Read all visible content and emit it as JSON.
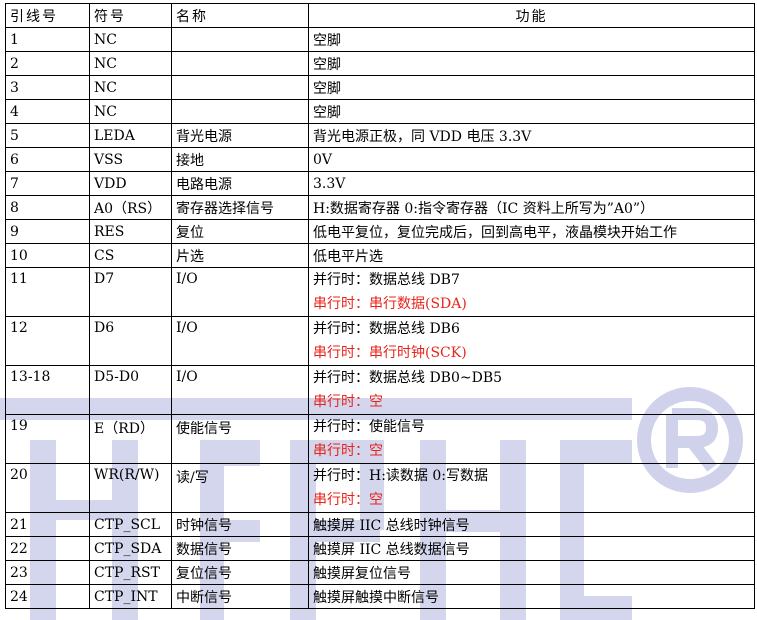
{
  "headers": [
    "引线号",
    "符号",
    "名称",
    "功能"
  ],
  "colors": {
    "border": "#000000",
    "red_text": "#e8241b",
    "watermark": "#cfd2ea"
  },
  "watermark": {
    "icon": "registered-trademark-icon"
  },
  "rows": [
    {
      "pin": "1",
      "symbol": "NC",
      "name": "",
      "func": [
        "空脚"
      ]
    },
    {
      "pin": "2",
      "symbol": "NC",
      "name": "",
      "func": [
        "空脚"
      ]
    },
    {
      "pin": "3",
      "symbol": "NC",
      "name": "",
      "func": [
        "空脚"
      ]
    },
    {
      "pin": "4",
      "symbol": "NC",
      "name": "",
      "func": [
        "空脚"
      ]
    },
    {
      "pin": "5",
      "symbol": "LEDA",
      "name": "背光电源",
      "func": [
        "背光电源正极，同 VDD 电压 3.3V"
      ]
    },
    {
      "pin": "6",
      "symbol": "VSS",
      "name": "接地",
      "func": [
        "0V"
      ]
    },
    {
      "pin": "7",
      "symbol": "VDD",
      "name": "电路电源",
      "func": [
        "3.3V"
      ]
    },
    {
      "pin": "8",
      "symbol": "A0（RS）",
      "name": "寄存器选择信号",
      "func": [
        "H:数据寄存器 0:指令寄存器（IC 资料上所写为”A0”）"
      ]
    },
    {
      "pin": "9",
      "symbol": "RES",
      "name": "复位",
      "func": [
        "低电平复位，复位完成后，回到高电平，液晶模块开始工作"
      ]
    },
    {
      "pin": "10",
      "symbol": "CS",
      "name": "片选",
      "func": [
        "低电平片选"
      ]
    },
    {
      "pin": "11",
      "symbol": "D7",
      "name": "I/O",
      "func": [
        "并行时：数据总线 DB7",
        "串行时：串行数据(SDA)"
      ]
    },
    {
      "pin": "12",
      "symbol": "D6",
      "name": "I/O",
      "func": [
        "并行时：数据总线 DB6",
        "串行时：串行时钟(SCK)"
      ]
    },
    {
      "pin": "13-18",
      "symbol": "D5-D0",
      "name": "I/O",
      "func": [
        "并行时：数据总线 DB0~DB5",
        "串行时：空"
      ]
    },
    {
      "pin": "19",
      "symbol": "E（RD）",
      "name": "使能信号",
      "func": [
        "并行时：使能信号",
        "串行时：空"
      ]
    },
    {
      "pin": "20",
      "symbol": "WR(R/W)",
      "name": "读/写",
      "func": [
        "并行时：H:读数据  0:写数据",
        "串行时：空"
      ]
    },
    {
      "pin": "21",
      "symbol": "CTP_SCL",
      "name": "时钟信号",
      "func": [
        "触摸屏 IIC 总线时钟信号"
      ]
    },
    {
      "pin": "22",
      "symbol": "CTP_SDA",
      "name": "数据信号",
      "func": [
        "触摸屏 IIC 总线数据信号"
      ]
    },
    {
      "pin": "23",
      "symbol": "CTP_RST",
      "name": "复位信号",
      "func": [
        "触摸屏复位信号"
      ]
    },
    {
      "pin": "24",
      "symbol": "CTP_INT",
      "name": "中断信号",
      "func": [
        "触摸屏触摸中断信号"
      ]
    }
  ]
}
